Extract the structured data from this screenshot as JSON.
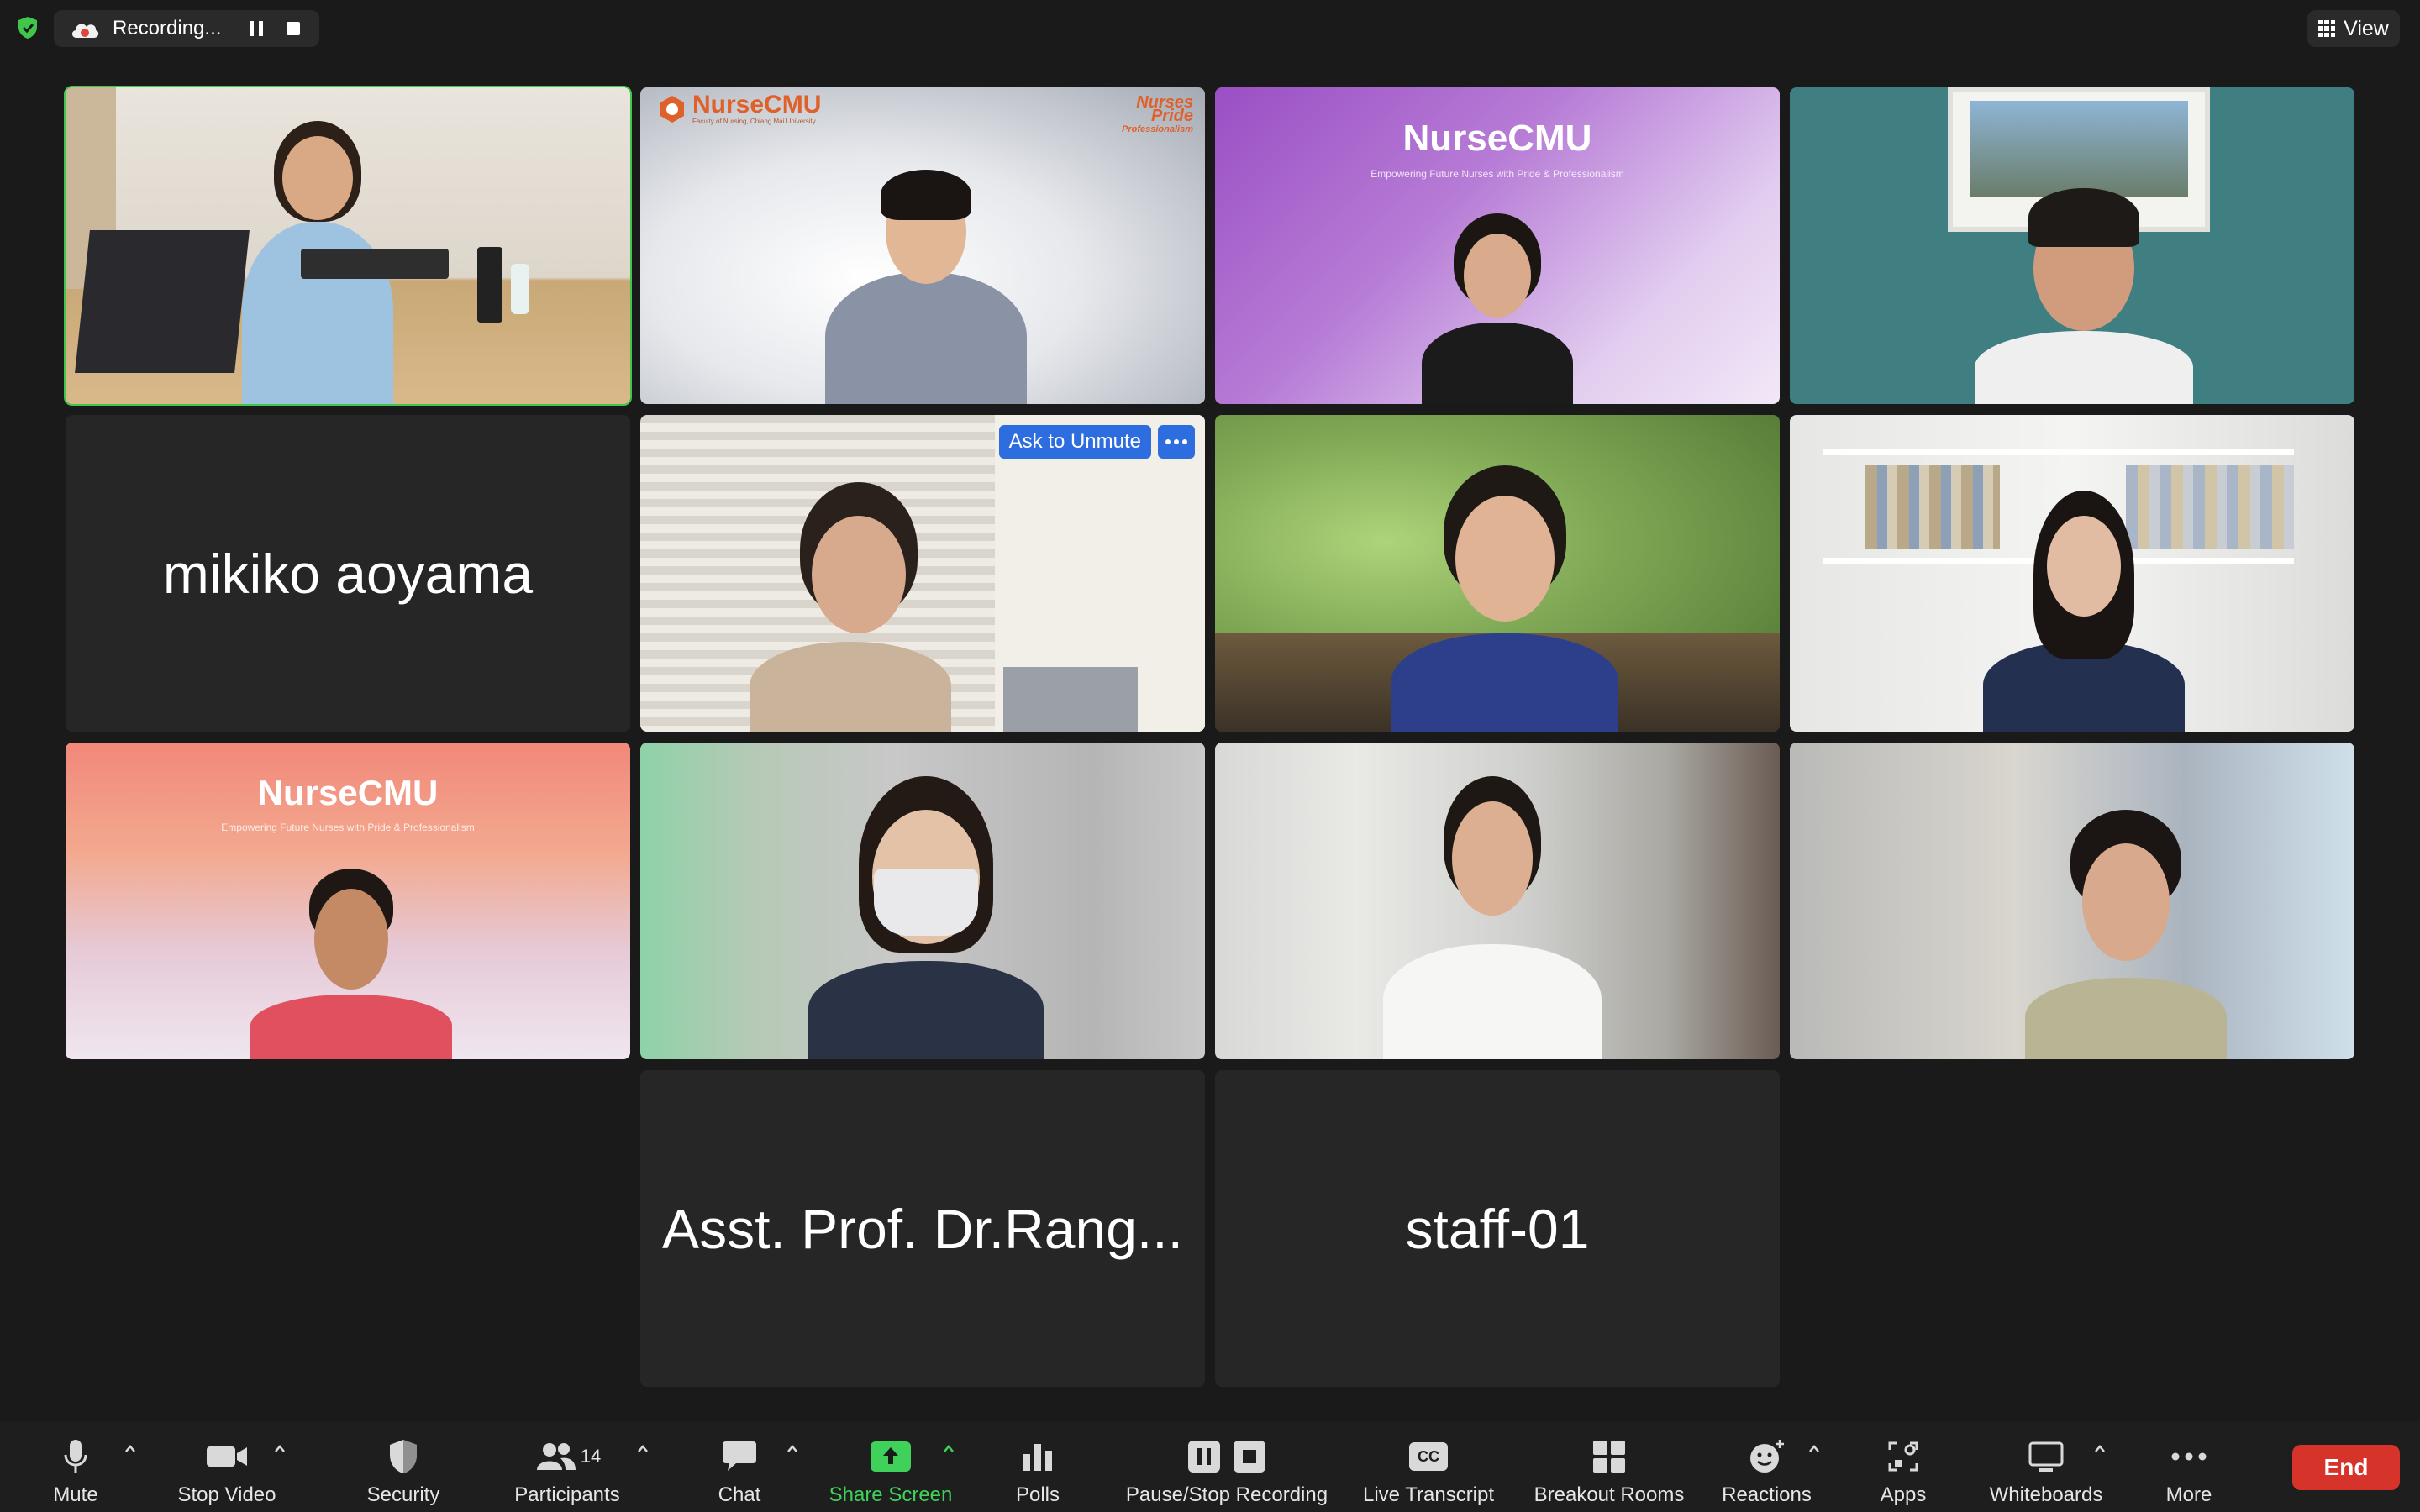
{
  "top_bar": {
    "recording_label": "Recording...",
    "view_label": "View"
  },
  "tiles": {
    "brand_name": "NurseCMU",
    "brand_tagline": "Empowering Future Nurses with Pride & Professionalism",
    "banner_brand": "NurseCMU",
    "banner_sub": "Faculty of Nursing, Chiang Mai University",
    "banner_slogan_1": "Nurses",
    "banner_slogan_2": "Pride",
    "banner_slogan_3": "Professionalism",
    "name_mikiko": "mikiko aoyama",
    "name_rang": "Asst. Prof. Dr.Rang...",
    "name_staff": "staff-01",
    "ask_to_unmute": "Ask to Unmute"
  },
  "toolbar": {
    "mute": "Mute",
    "stop_video": "Stop Video",
    "security": "Security",
    "participants": "Participants",
    "participants_count": "14",
    "chat": "Chat",
    "share_screen": "Share Screen",
    "polls": "Polls",
    "pause_stop_recording": "Pause/Stop Recording",
    "live_transcript": "Live Transcript",
    "cc": "CC",
    "breakout_rooms": "Breakout Rooms",
    "reactions": "Reactions",
    "apps": "Apps",
    "whiteboards": "Whiteboards",
    "more": "More",
    "end": "End"
  },
  "colors": {
    "background": "#1a1a1a",
    "active_speaker": "#3fc64b",
    "share_green": "#3fd15a",
    "end_red": "#d6332b",
    "ask_blue": "#2e6de0"
  }
}
